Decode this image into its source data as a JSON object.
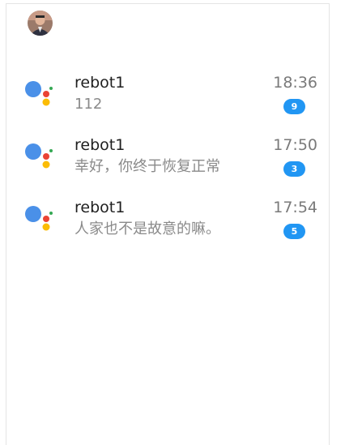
{
  "header": {
    "avatar_icon": "user-avatar-icon"
  },
  "chats": [
    {
      "name": "rebot1",
      "message": "112",
      "time": "18:36",
      "unread": "9",
      "icon": "assistant-dots-icon"
    },
    {
      "name": "rebot1",
      "message": "幸好，你终于恢复正常",
      "time": "17:50",
      "unread": "3",
      "icon": "assistant-dots-icon"
    },
    {
      "name": "rebot1",
      "message": "人家也不是故意的嘛。",
      "time": "17:54",
      "unread": "5",
      "icon": "assistant-dots-icon"
    }
  ],
  "colors": {
    "badge": "#2196f3",
    "dot_blue": "#4285f4",
    "dot_red": "#ea4335",
    "dot_yellow": "#fbbc05",
    "dot_green": "#34a853"
  }
}
